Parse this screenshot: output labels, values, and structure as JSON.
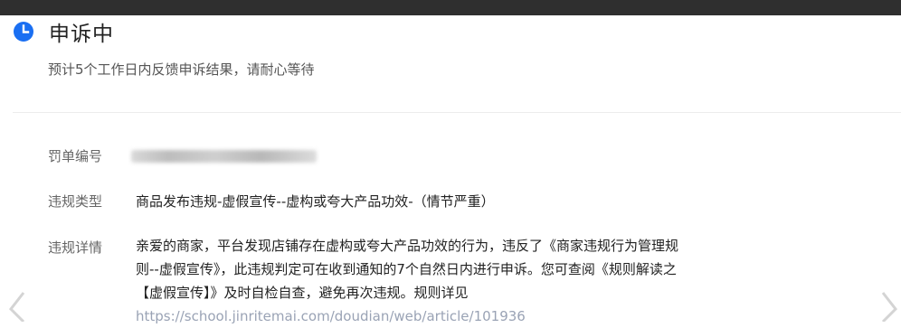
{
  "status": {
    "title": "申诉中",
    "subtitle": "预计5个工作日内反馈申诉结果，请耐心等待",
    "icon": "clock-icon"
  },
  "details": {
    "penalty_number_label": "罚单编号",
    "violation_type_label": "违规类型",
    "violation_type_value": "商品发布违规-虚假宣传--虚构或夸大产品功效-（情节严重）",
    "violation_detail_label": "违规详情",
    "violation_detail_lines": [
      "亲爱的商家，平台发现店铺存在虚构或夸大产品功效的行为，违反了《商家违规行为管理规",
      "则--虚假宣传》，此违规判定可在收到通知的7个自然日内进行申诉。您可查阅《规则解读之",
      "【虚假宣传】》及时自检自查，避免再次违规。规则详见",
      "https://school.jinritemai.com/doudian/web/article/101936"
    ]
  },
  "colors": {
    "accent": "#1a6ff2",
    "topbar": "#2f2f2f",
    "text": "#222222",
    "label": "#666666"
  }
}
